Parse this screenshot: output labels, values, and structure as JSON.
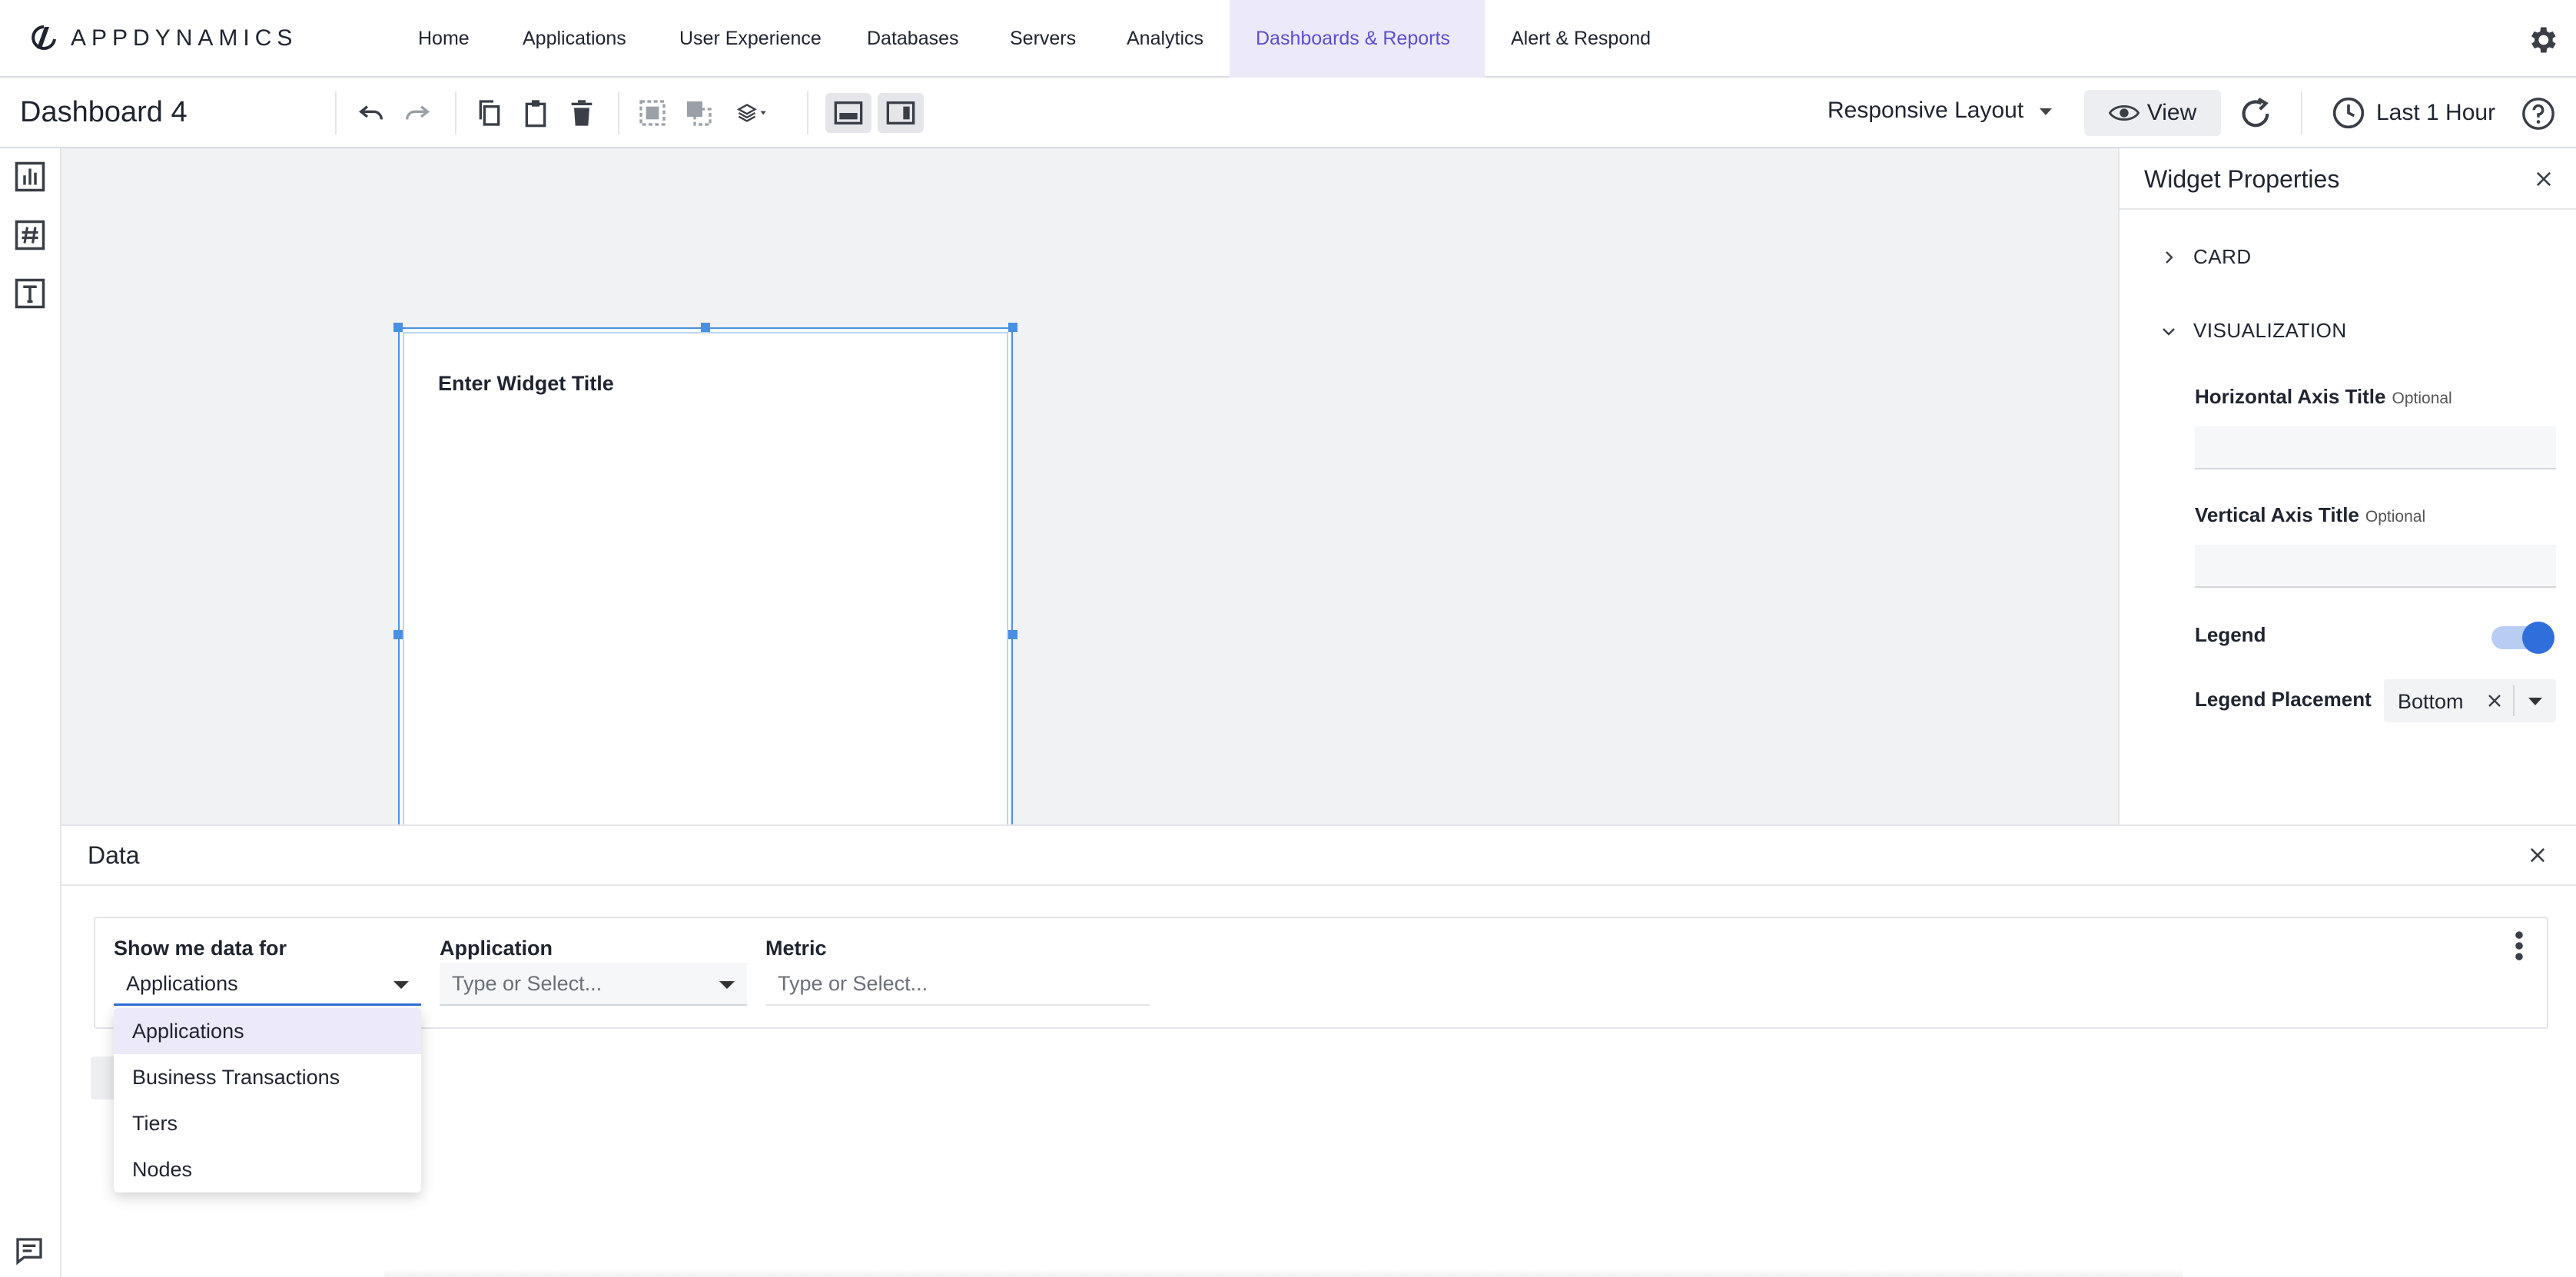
{
  "brand": {
    "name": "APPDYNAMICS"
  },
  "nav": {
    "items": [
      {
        "label": "Home"
      },
      {
        "label": "Applications"
      },
      {
        "label": "User Experience"
      },
      {
        "label": "Databases"
      },
      {
        "label": "Servers"
      },
      {
        "label": "Analytics"
      },
      {
        "label": "Dashboards & Reports",
        "active": true
      },
      {
        "label": "Alert & Respond"
      }
    ]
  },
  "toolbar": {
    "dashboard_title": "Dashboard 4",
    "layout_label": "Responsive Layout",
    "view_label": "View",
    "time_range_label": "Last 1 Hour"
  },
  "widget": {
    "title": "Enter Widget Title"
  },
  "properties": {
    "title": "Widget Properties",
    "sections": {
      "card": "CARD",
      "visualization": "VISUALIZATION"
    },
    "horizontal_axis_label": "Horizontal Axis Title",
    "horizontal_axis_value": "",
    "vertical_axis_label": "Vertical Axis Title",
    "vertical_axis_value": "",
    "optional_tag": "Optional",
    "legend_label": "Legend",
    "legend_enabled": true,
    "legend_placement_label": "Legend Placement",
    "legend_placement_value": "Bottom"
  },
  "data_panel": {
    "title": "Data",
    "show_me_label": "Show me data for",
    "show_me_value": "Applications",
    "application_label": "Application",
    "application_placeholder": "Type or Select...",
    "metric_label": "Metric",
    "metric_placeholder": "Type or Select...",
    "dropdown_options": [
      {
        "label": "Applications",
        "selected": true
      },
      {
        "label": "Business Transactions"
      },
      {
        "label": "Tiers"
      },
      {
        "label": "Nodes"
      }
    ]
  },
  "colors": {
    "accent": "#5b4fd1",
    "active_nav_bg": "#ece9fb",
    "selection_blue": "#4a90e2",
    "toggle_on": "#2f6fdc"
  }
}
